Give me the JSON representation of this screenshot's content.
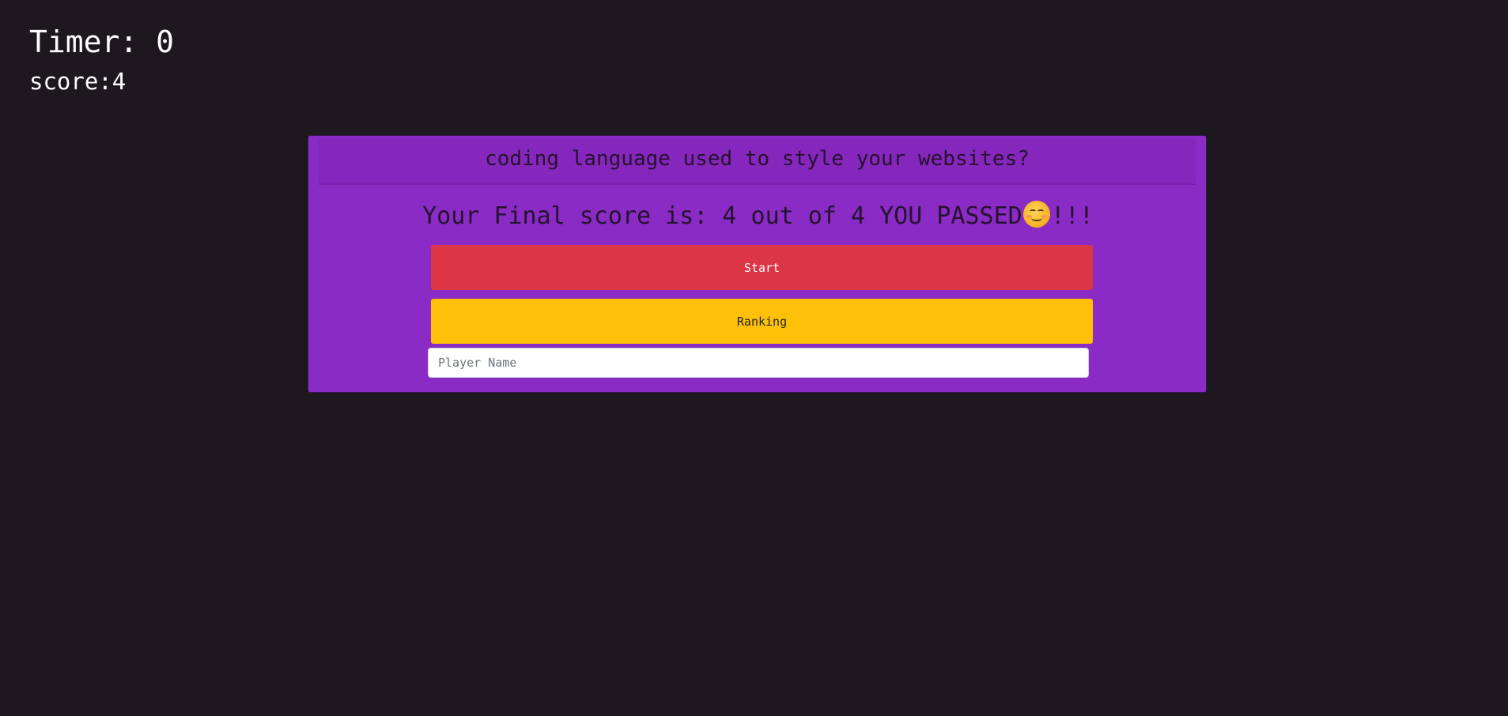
{
  "hud": {
    "timer_text": "Timer: 0",
    "score_text": "score:4"
  },
  "quiz": {
    "question": "coding language used to style your websites?",
    "final_score_text": "Your Final score is: 4 out of 4 YOU PASSED",
    "final_score_suffix": "!!!",
    "emoji_icon": "smiling-face-icon",
    "start_label": "Start",
    "ranking_label": "Ranking",
    "player_name_placeholder": "Player Name",
    "player_name_value": ""
  },
  "colors": {
    "background": "#1c181d",
    "card": "#8a2bc6",
    "start_button": "#dc3545",
    "ranking_button": "#ffc107"
  }
}
